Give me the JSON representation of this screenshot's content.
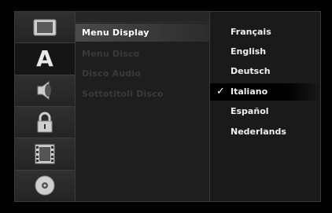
{
  "sidebar": {
    "icons": [
      "tv-display-icon",
      "language-a-icon",
      "audio-speaker-icon",
      "lock-icon",
      "film-icon",
      "disc-icon"
    ],
    "active_index": 1,
    "language_letter": "A"
  },
  "menu": {
    "items": [
      {
        "label": "Menu Display"
      },
      {
        "label": "Menu Disco"
      },
      {
        "label": "Disco Audio"
      },
      {
        "label": "Sottotitoli Disco"
      }
    ]
  },
  "options": {
    "items": [
      {
        "label": "Français"
      },
      {
        "label": "English"
      },
      {
        "label": "Deutsch"
      },
      {
        "label": "Italiano"
      },
      {
        "label": "Español"
      },
      {
        "label": "Nederlands"
      }
    ],
    "selected_index": 3,
    "check_glyph": "✓"
  }
}
